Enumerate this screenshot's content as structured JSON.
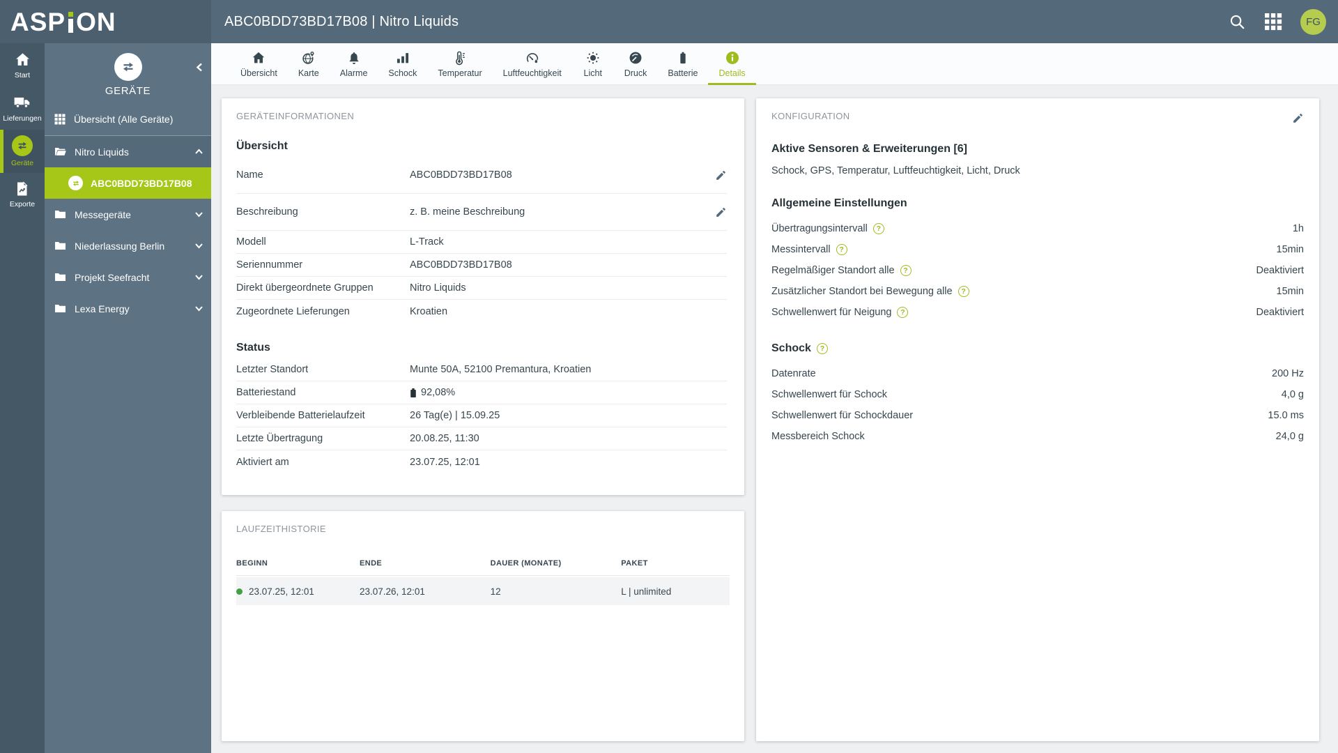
{
  "brand": {
    "name": "ASPION",
    "logo_pre": "ASP",
    "logo_post": "ON"
  },
  "header": {
    "title": "ABC0BDD73BD17B08 | Nitro Liquids",
    "avatar_initials": "FG"
  },
  "rail": {
    "items": [
      {
        "label": "Start"
      },
      {
        "label": "Lieferungen"
      },
      {
        "label": "Geräte"
      },
      {
        "label": "Exporte"
      }
    ]
  },
  "sidebar": {
    "title": "GERÄTE",
    "items": [
      {
        "label": "Übersicht (Alle Geräte)"
      },
      {
        "label": "Nitro Liquids"
      },
      {
        "label": "ABC0BDD73BD17B08"
      },
      {
        "label": "Messegeräte"
      },
      {
        "label": "Niederlassung Berlin"
      },
      {
        "label": "Projekt Seefracht"
      },
      {
        "label": "Lexa Energy"
      }
    ]
  },
  "tabs": [
    {
      "label": "Übersicht"
    },
    {
      "label": "Karte"
    },
    {
      "label": "Alarme"
    },
    {
      "label": "Schock"
    },
    {
      "label": "Temperatur"
    },
    {
      "label": "Luftfeuchtigkeit"
    },
    {
      "label": "Licht"
    },
    {
      "label": "Druck"
    },
    {
      "label": "Batterie"
    },
    {
      "label": "Details",
      "active": true
    }
  ],
  "device_info": {
    "panel_title": "GERÄTEINFORMATIONEN",
    "section_overview": "Übersicht",
    "overview_rows": [
      {
        "label": "Name",
        "value": "ABC0BDD73BD17B08",
        "editable": true
      },
      {
        "label": "Beschreibung",
        "value": "z. B. meine Beschreibung",
        "editable": true
      },
      {
        "label": "Modell",
        "value": "L-Track"
      },
      {
        "label": "Seriennummer",
        "value": "ABC0BDD73BD17B08"
      },
      {
        "label": "Direkt übergeordnete Gruppen",
        "value": "Nitro Liquids"
      },
      {
        "label": "Zugeordnete Lieferungen",
        "value": "Kroatien"
      }
    ],
    "section_status": "Status",
    "status_rows": [
      {
        "label": "Letzter Standort",
        "value": "Munte 50A, 52100 Premantura, Kroatien"
      },
      {
        "label": "Batteriestand",
        "value": "92,08%",
        "icon": "battery"
      },
      {
        "label": "Verbleibende Batterielaufzeit",
        "value": "26 Tag(e)  |  15.09.25"
      },
      {
        "label": "Letzte Übertragung",
        "value": "20.08.25, 11:30"
      },
      {
        "label": "Aktiviert am",
        "value": "23.07.25, 12:01"
      }
    ]
  },
  "config": {
    "panel_title": "KONFIGURATION",
    "sensors_heading": "Aktive Sensoren & Erweiterungen [6]",
    "sensors_list": "Schock, GPS, Temperatur, Luftfeuchtigkeit, Licht, Druck",
    "general_heading": "Allgemeine Einstellungen",
    "general_rows": [
      {
        "label": "Übertragungsintervall",
        "value": "1h",
        "help": true
      },
      {
        "label": "Messintervall",
        "value": "15min",
        "help": true
      },
      {
        "label": "Regelmäßiger Standort alle",
        "value": "Deaktiviert",
        "help": true
      },
      {
        "label": "Zusätzlicher Standort bei Bewegung alle",
        "value": "15min",
        "help": true
      },
      {
        "label": "Schwellenwert für Neigung",
        "value": "Deaktiviert",
        "help": true
      }
    ],
    "schock_heading": "Schock",
    "schock_rows": [
      {
        "label": "Datenrate",
        "value": "200 Hz"
      },
      {
        "label": "Schwellenwert für Schock",
        "value": "4,0 g"
      },
      {
        "label": "Schwellenwert für Schockdauer",
        "value": "15.0 ms"
      },
      {
        "label": "Messbereich Schock",
        "value": "24,0 g"
      }
    ]
  },
  "history": {
    "panel_title": "LAUFZEITHISTORIE",
    "columns": [
      "BEGINN",
      "ENDE",
      "DAUER (MONATE)",
      "PAKET"
    ],
    "rows": [
      {
        "beginn": "23.07.25, 12:01",
        "ende": "23.07.26, 12:01",
        "dauer": "12",
        "paket": "L | unlimited"
      }
    ]
  },
  "colors": {
    "accent": "#a6c717",
    "accent_text": "#9ebc1e",
    "status_dot": "#43a047",
    "header": "#546a7b",
    "sidebar": "#5d7383",
    "rail": "#455866"
  }
}
